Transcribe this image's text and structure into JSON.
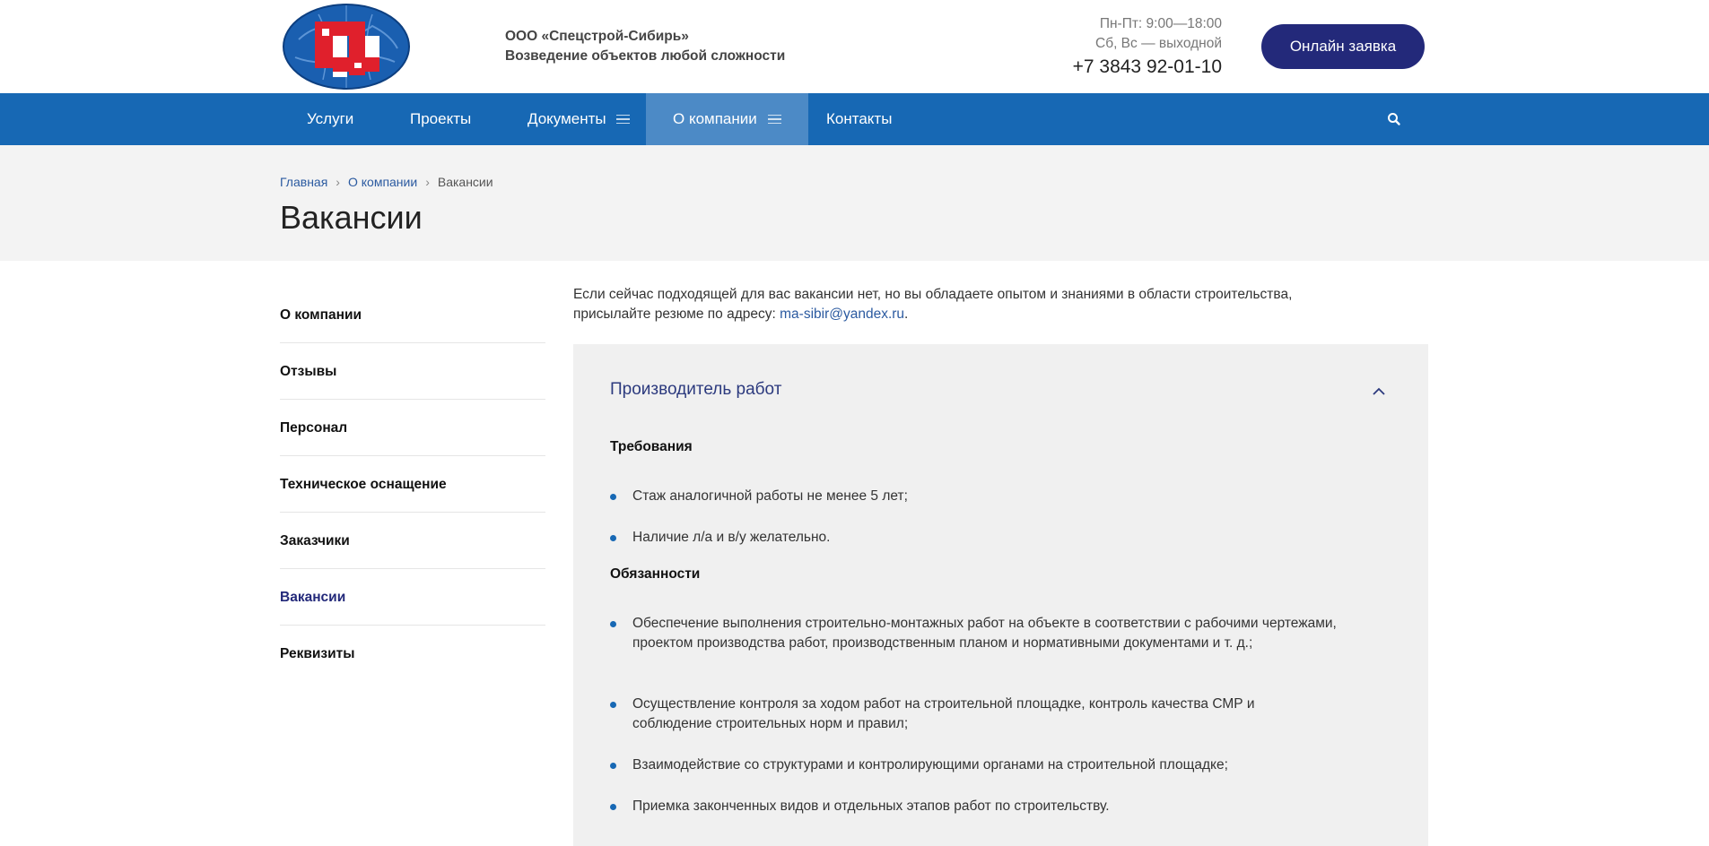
{
  "header": {
    "company_name": "ООО «Спецстрой-Сибирь»",
    "tagline": "Возведение объектов любой сложности",
    "hours_weekdays": "Пн-Пт: 9:00—18:00",
    "hours_weekend": "Сб, Вс — выходной",
    "phone": "+7 3843 92-01-10",
    "cta_label": "Онлайн заявка"
  },
  "nav": {
    "items": [
      {
        "label": "Услуги"
      },
      {
        "label": "Проекты"
      },
      {
        "label": "Документы"
      },
      {
        "label": "О компании"
      },
      {
        "label": "Контакты"
      }
    ]
  },
  "breadcrumb": [
    "Главная",
    "О компании",
    "Вакансии"
  ],
  "page_title": "Вакансии",
  "sidebar": {
    "items": [
      {
        "label": "О компании"
      },
      {
        "label": "Отзывы"
      },
      {
        "label": "Персонал"
      },
      {
        "label": "Техническое оснащение"
      },
      {
        "label": "Заказчики"
      },
      {
        "label": "Вакансии"
      },
      {
        "label": "Реквизиты"
      }
    ]
  },
  "intro": {
    "text_line1": "Если сейчас подходящей для вас вакансии нет, но вы обладаете опытом и знаниями в области строительства,",
    "text_line2": "присылайте резюме по адресу: ",
    "email": "ma-sibir@yandex.ru",
    "end": "."
  },
  "vacancy": {
    "title": "Производитель работ",
    "requirements_heading": "Требования",
    "requirements": [
      "Стаж аналогичной работы не менее 5 лет;",
      "Наличие л/а и в/у желательно."
    ],
    "duties_heading": "Обязанности",
    "duties": [
      "Обеспечение выполнения строительно-монтажных работ на объекте в соответствии с рабочими чертежами, проектом производства работ, производственным планом и нормативными документами и т. д.;",
      "Осуществление контроля за ходом работ на строительной площадке, контроль качества СМР и соблюдение строительных норм и правил;",
      "Взаимодействие со структурами и контролирующими органами на строительной площадке;",
      "Приемка законченных видов и отдельных этапов работ по строительству."
    ]
  },
  "colors": {
    "nav_bg": "#1768b4",
    "nav_active": "#4c8ac6",
    "cta_bg": "#23297a",
    "accent_title": "#2c3a7e",
    "logo_red": "#e0202c",
    "logo_blue": "#1a5fb0"
  },
  "icons": [
    "logo-emblem",
    "burger-icon",
    "search-icon",
    "chevron-up-icon"
  ]
}
